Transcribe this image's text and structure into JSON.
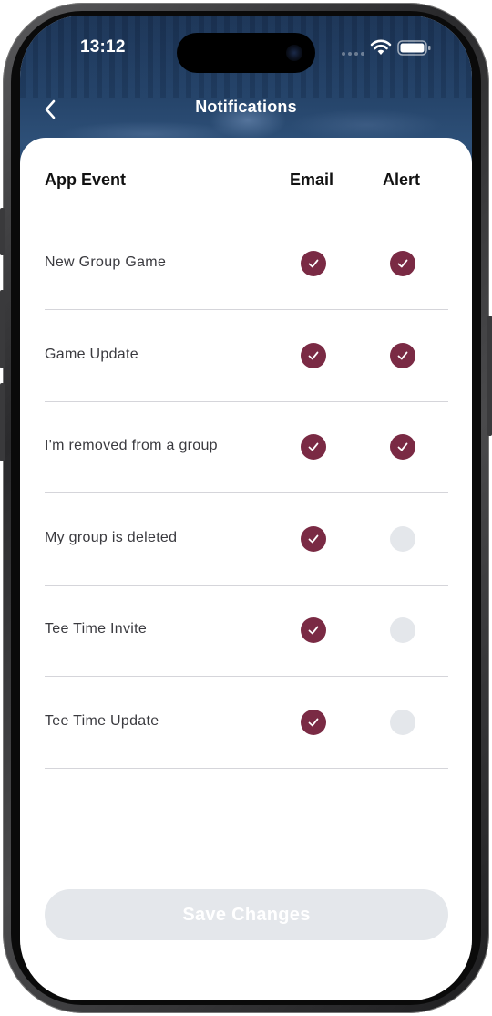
{
  "status_bar": {
    "time": "13:12"
  },
  "nav": {
    "title": "Notifications",
    "back_icon": "chevron-left-icon"
  },
  "table": {
    "headers": {
      "event": "App Event",
      "email": "Email",
      "alert": "Alert"
    },
    "rows": [
      {
        "label": "New Group Game",
        "email": true,
        "alert": true
      },
      {
        "label": "Game Update",
        "email": true,
        "alert": true
      },
      {
        "label": "I'm removed from a group",
        "email": true,
        "alert": true
      },
      {
        "label": "My group is deleted",
        "email": true,
        "alert": false
      },
      {
        "label": "Tee Time Invite",
        "email": true,
        "alert": false
      },
      {
        "label": "Tee Time Update",
        "email": true,
        "alert": false
      }
    ]
  },
  "footer": {
    "save_label": "Save Changes"
  },
  "colors": {
    "accent": "#7a2a44",
    "disabled": "#e4e7eb",
    "header_bg": "#25446a"
  }
}
